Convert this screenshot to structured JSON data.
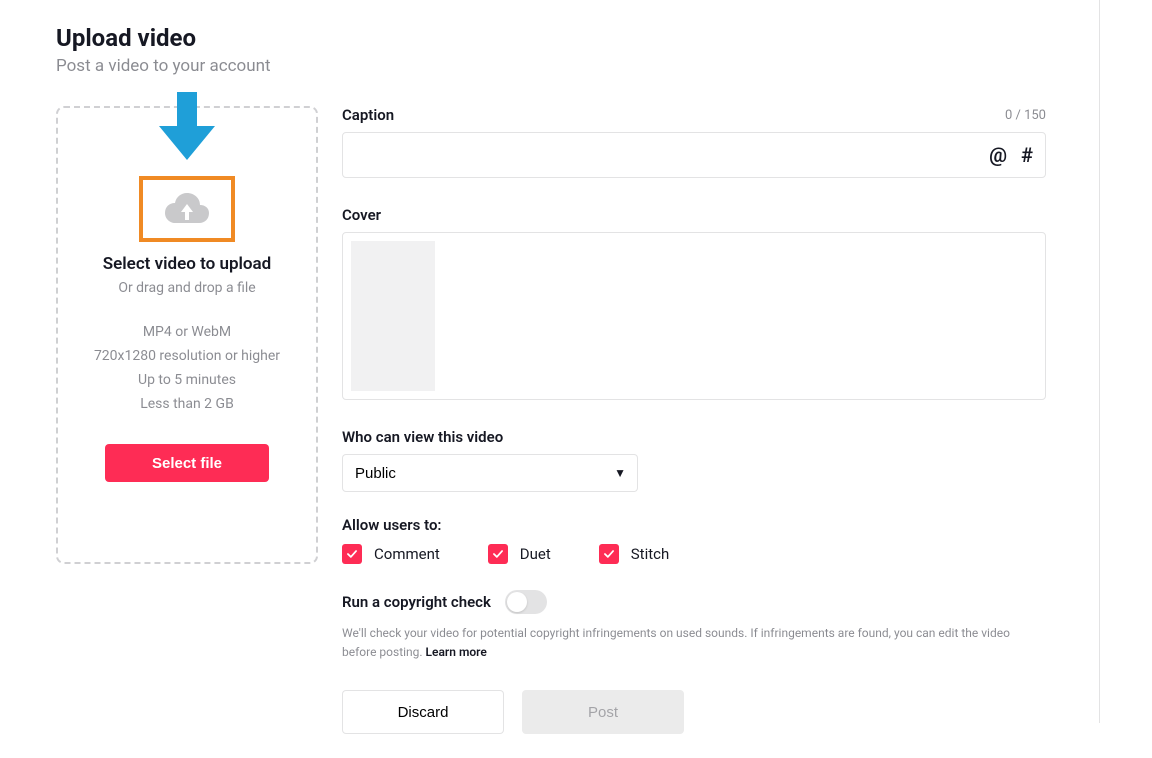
{
  "header": {
    "title": "Upload video",
    "subtitle": "Post a video to your account"
  },
  "upload": {
    "select_title": "Select video to upload",
    "drag_text": "Or drag and drop a file",
    "specs": [
      "MP4 or WebM",
      "720x1280 resolution or higher",
      "Up to 5 minutes",
      "Less than 2 GB"
    ],
    "button": "Select file"
  },
  "caption": {
    "label": "Caption",
    "counter": "0 / 150",
    "value": "",
    "at_symbol": "@",
    "hash_symbol": "#"
  },
  "cover": {
    "label": "Cover"
  },
  "visibility": {
    "label": "Who can view this video",
    "selected": "Public"
  },
  "permissions": {
    "label": "Allow users to:",
    "options": [
      {
        "label": "Comment",
        "checked": true
      },
      {
        "label": "Duet",
        "checked": true
      },
      {
        "label": "Stitch",
        "checked": true
      }
    ]
  },
  "copyright": {
    "label": "Run a copyright check",
    "enabled": false,
    "description": "We'll check your video for potential copyright infringements on used sounds. If infringements are found, you can edit the video before posting. ",
    "learn_more": "Learn more"
  },
  "actions": {
    "discard": "Discard",
    "post": "Post"
  }
}
